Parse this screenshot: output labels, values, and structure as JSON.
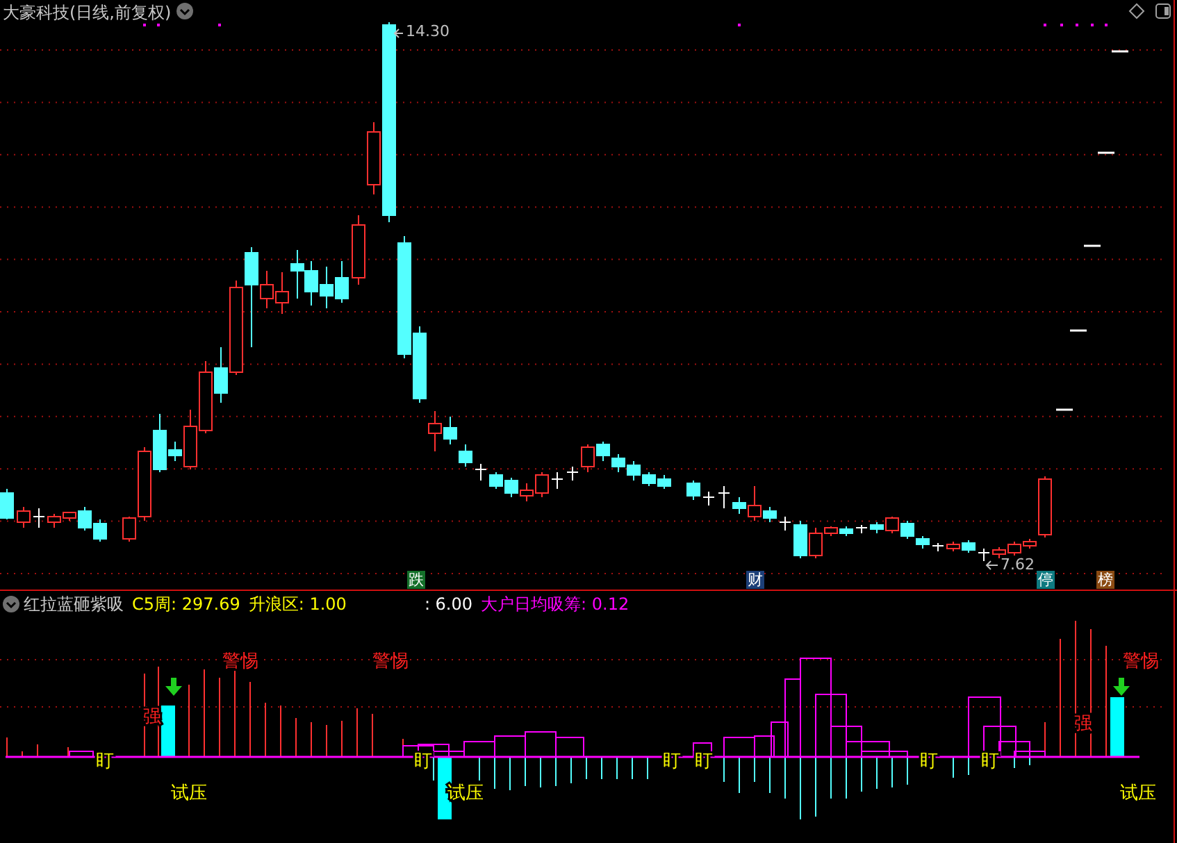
{
  "title": "大豪科技(日线,前复权)",
  "price_labels": [
    {
      "text": "14.30"
    },
    {
      "text": "7.62"
    }
  ],
  "event_markers": [
    {
      "text": "跌",
      "color": "#14702a"
    },
    {
      "text": "财",
      "color": "#1c3f78"
    },
    {
      "text": "停",
      "color": "#0e7a80"
    },
    {
      "text": "榜",
      "color": "#8a4a12"
    }
  ],
  "indicator": {
    "name": "红拉蓝砸紫吸",
    "values": [
      {
        "text": "C5周: 297.69",
        "color": "#ffff00"
      },
      {
        "text": "升浪区: 1.00",
        "color": "#ffff00"
      },
      {
        "text": ": 6.00",
        "color": "#ffffff"
      },
      {
        "text": "大户日均吸筹: 0.12",
        "color": "#ff00ff"
      }
    ]
  },
  "signals": [
    {
      "kind": "warning",
      "text": "警惕"
    },
    {
      "kind": "warning",
      "text": "警惕"
    },
    {
      "kind": "warning",
      "text": "警惕"
    },
    {
      "kind": "strong",
      "text": "强"
    },
    {
      "kind": "strong",
      "text": "强"
    },
    {
      "kind": "watch",
      "text": "盯"
    },
    {
      "kind": "watch",
      "text": "盯"
    },
    {
      "kind": "watch",
      "text": "盯"
    },
    {
      "kind": "watch",
      "text": "盯"
    },
    {
      "kind": "watch",
      "text": "盯"
    },
    {
      "kind": "watch",
      "text": "盯"
    },
    {
      "kind": "test",
      "text": "试压"
    },
    {
      "kind": "test",
      "text": "试压"
    },
    {
      "kind": "test",
      "text": "试压"
    }
  ]
}
